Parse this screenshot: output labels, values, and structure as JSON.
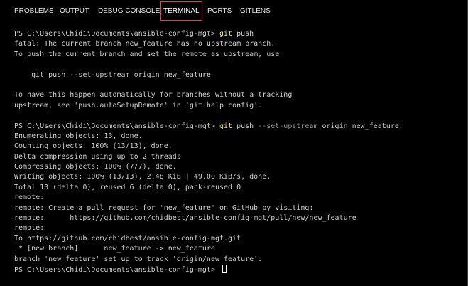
{
  "tabs": [
    {
      "label": "PROBLEMS"
    },
    {
      "label": "OUTPUT"
    },
    {
      "label": "DEBUG CONSOLE"
    },
    {
      "label": "TERMINAL"
    },
    {
      "label": "PORTS"
    },
    {
      "label": "GITLENS"
    }
  ],
  "terminal": {
    "prompt": "PS C:\\Users\\Chidi\\Documents\\ansible-config-mgt> ",
    "cmd1": {
      "git": "git",
      "args": " push"
    },
    "out1": [
      "fatal: The current branch new_feature has no upstream branch.",
      "To push the current branch and set the remote as upstream, use",
      "",
      "    git push --set-upstream origin new_feature",
      "",
      "To have this happen automatically for branches without a tracking",
      "upstream, see 'push.autoSetupRemote' in 'git help config'.",
      ""
    ],
    "cmd2": {
      "git": "git",
      "push": " push ",
      "flag": "--set-upstream",
      "rest": " origin new_feature"
    },
    "out2": [
      "Enumerating objects: 13, done.",
      "Counting objects: 100% (13/13), done.",
      "Delta compression using up to 2 threads",
      "Compressing objects: 100% (7/7), done.",
      "Writing objects: 100% (13/13), 2.48 KiB | 49.00 KiB/s, done.",
      "Total 13 (delta 0), reused 6 (delta 0), pack-reused 0",
      "remote:",
      "remote: Create a pull request for 'new_feature' on GitHub by visiting:",
      "remote:      https://github.com/chidbest/ansible-config-mgt/pull/new/new_feature",
      "remote:",
      "To https://github.com/chidbest/ansible-config-mgt.git",
      " * [new branch]      new_feature -> new_feature",
      "branch 'new_feature' set up to track 'origin/new_feature'."
    ]
  }
}
